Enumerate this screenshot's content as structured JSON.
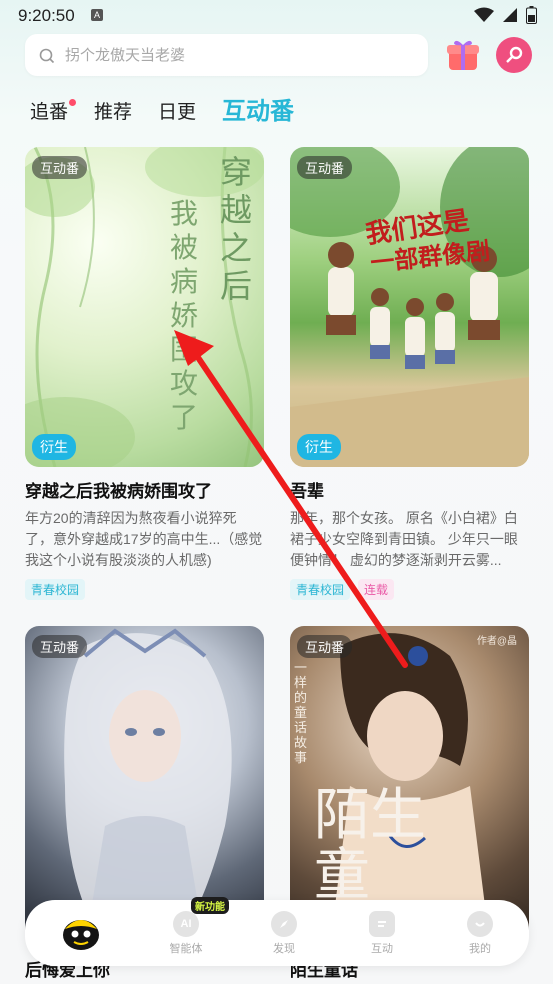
{
  "status_bar": {
    "time": "9:20:50",
    "a_icon": "A"
  },
  "search": {
    "placeholder": "拐个龙傲天当老婆"
  },
  "tabs": [
    {
      "label": "追番",
      "has_dot": true
    },
    {
      "label": "推荐"
    },
    {
      "label": "日更"
    },
    {
      "label": "互动番",
      "active": true
    }
  ],
  "cards": [
    {
      "badge_top": "互动番",
      "badge_bottom": "衍生",
      "cover_text": [
        "穿越之后",
        "我被病娇围攻了"
      ],
      "title": "穿越之后我被病娇围攻了",
      "desc": "年方20的清辞因为熬夜看小说猝死了，意外穿越成17岁的高中生...（感觉我这个小说有股淡淡的人机感)",
      "tags": [
        {
          "label": "青春校园",
          "style": "blue"
        }
      ]
    },
    {
      "badge_top": "互动番",
      "badge_bottom": "衍生",
      "cover_text": [
        "我们这是",
        "一部群像剧"
      ],
      "title": "吾辈",
      "desc": "那年，那个女孩。 原名《小白裙》白裙子少女空降到青田镇。 少年只一眼便钟情！ 虚幻的梦逐渐剥开云雾...",
      "tags": [
        {
          "label": "青春校园",
          "style": "blue"
        },
        {
          "label": "连载",
          "style": "pink"
        }
      ]
    },
    {
      "badge_top": "互动番",
      "title": "后悔爱上你"
    },
    {
      "badge_top": "互动番",
      "cover_text": [
        "作者@晶",
        "一样的童话故事",
        "陌生童"
      ],
      "title": "陌生童话"
    }
  ],
  "bottom_nav": [
    {
      "label": "",
      "icon": "mascot-icon"
    },
    {
      "label": "智能体",
      "icon": "ai-icon",
      "icon_text": "AI",
      "badge": "新功能"
    },
    {
      "label": "发现",
      "icon": "discover-icon"
    },
    {
      "label": "互动",
      "icon": "interact-icon"
    },
    {
      "label": "我的",
      "icon": "profile-icon"
    }
  ]
}
